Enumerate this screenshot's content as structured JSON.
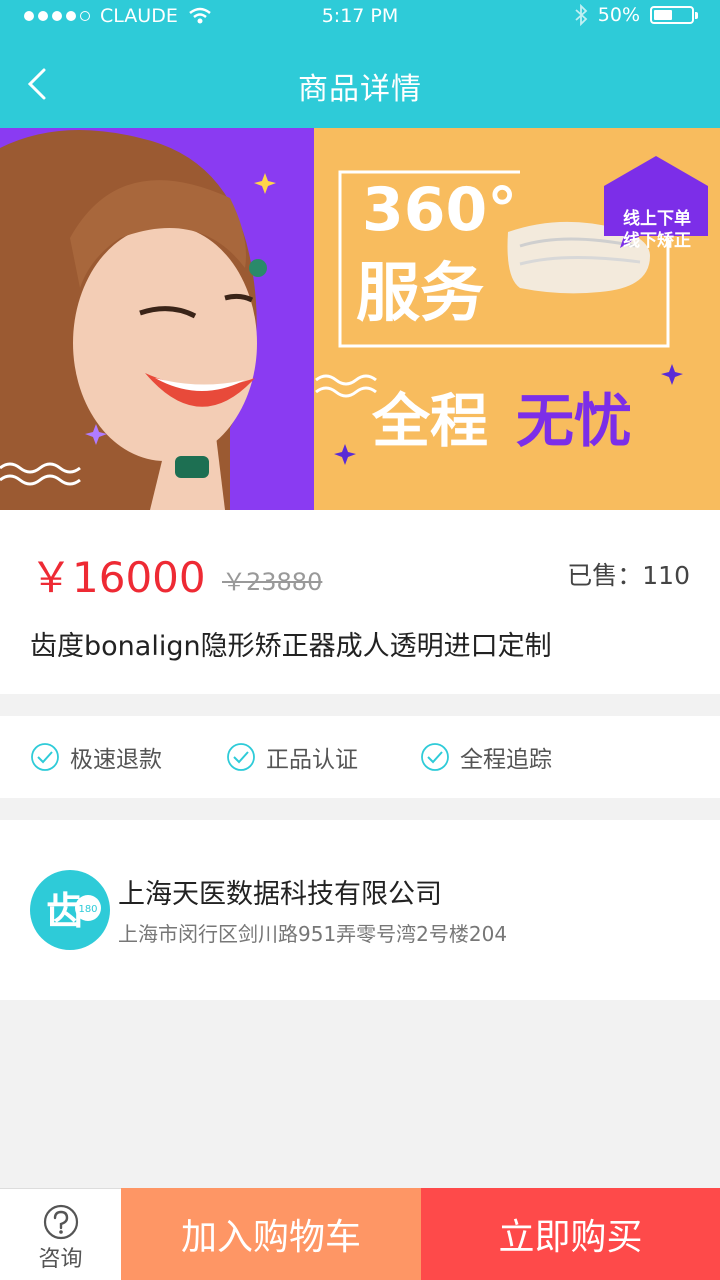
{
  "status_bar": {
    "carrier": "CLAUDE",
    "time": "5:17 PM",
    "battery": "50%",
    "battery_level": 0.5
  },
  "nav": {
    "title": "商品详情"
  },
  "banner": {
    "line1": "360°",
    "line2": "服务",
    "tag_line1": "线上下单",
    "tag_line2": "线下矫正",
    "slogan_a": "全程",
    "slogan_b": "无忧",
    "colors": {
      "left": "#8a3bf2",
      "right": "#f8bc5e"
    }
  },
  "product": {
    "price": "￥16000",
    "original_price": "￥23880",
    "sold": "已售：110",
    "name": "齿度bonalign隐形矫正器成人透明进口定制"
  },
  "guarantees": [
    {
      "label": "极速退款"
    },
    {
      "label": "正品认证"
    },
    {
      "label": "全程追踪"
    }
  ],
  "shop": {
    "name": "上海天医数据科技有限公司",
    "address": "上海市闵行区剑川路951弄零号湾2号楼204",
    "logo_text": "齿",
    "logo_badge": "180"
  },
  "bottom_bar": {
    "consult": "咨询",
    "add_to_cart": "加入购物车",
    "buy_now": "立即购买"
  },
  "colors": {
    "accent": "#2ecbd8",
    "price": "#ee2a34",
    "cart": "#fe9665",
    "buy": "#fe4a4a"
  }
}
